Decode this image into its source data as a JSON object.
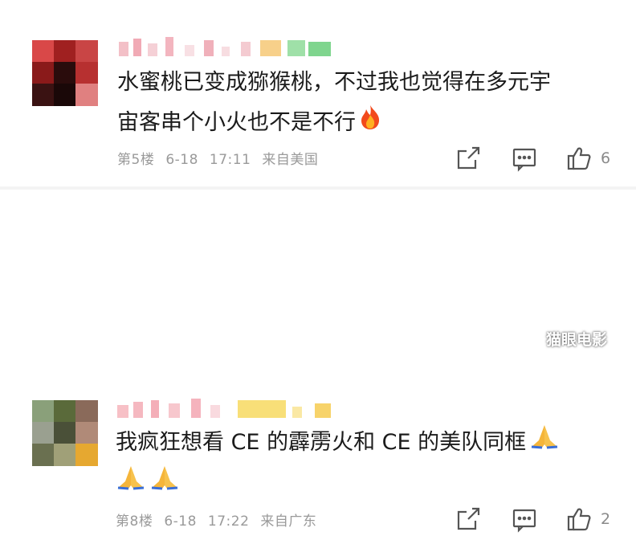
{
  "comments": [
    {
      "text_line1": "水蜜桃已变成猕猴桃，不过我也觉得在多元宇",
      "text_line2": "宙客串个小火也不是不行",
      "emoji": "fire-emoji",
      "floor": "第5楼",
      "date": "6-18",
      "time": "17:11",
      "location": "来自美国",
      "likes": "6"
    },
    {
      "text_line1": "我疯狂想看 CE 的霹雳火和 CE 的美队同框",
      "emoji": "pray-emoji",
      "floor": "第8楼",
      "date": "6-18",
      "time": "17:22",
      "location": "来自广东",
      "likes": "2"
    }
  ],
  "watermark": "猫眼电影",
  "icons": [
    "share-icon",
    "comment-icon",
    "thumbs-up-icon"
  ]
}
